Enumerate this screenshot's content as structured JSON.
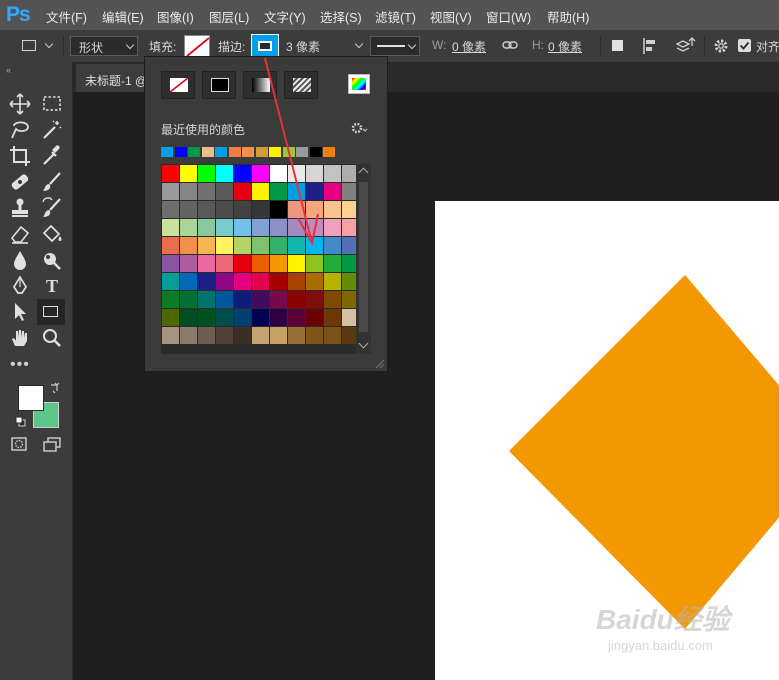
{
  "app": {
    "logo": "Ps"
  },
  "menu": [
    "文件(F)",
    "编辑(E)",
    "图像(I)",
    "图层(L)",
    "文字(Y)",
    "选择(S)",
    "滤镜(T)",
    "视图(V)",
    "窗口(W)",
    "帮助(H)"
  ],
  "options": {
    "mode": "形状",
    "fill_label": "填充:",
    "stroke_label": "描边:",
    "stroke_width": "3 像素",
    "w_label": "W:",
    "w_value": "0 像素",
    "h_label": "H:",
    "h_value": "0 像素",
    "align_label": "对齐"
  },
  "document": {
    "tab_title": "未标题-1 @"
  },
  "popup": {
    "recent_label": "最近使用的颜色",
    "recent_colors": [
      "#00a0e9",
      "#0000ff",
      "#009944",
      "#e6c08c",
      "#00a0e9",
      "#ef7e45",
      "#f19149",
      "#d69c3c",
      "#fff000",
      "#9aca3c",
      "#999999",
      "#000000",
      "#ea8010"
    ],
    "swatch_rows": [
      [
        "#ff0000",
        "#ffff00",
        "#00ff00",
        "#00ffff",
        "#0000ff",
        "#ff00ff",
        "#ffffff",
        "#ebebeb",
        "#d6d6d6",
        "#c2c2c2",
        "#adadad"
      ],
      [
        "#999999",
        "#858585",
        "#707070",
        "#5c5c5c",
        "#e60012",
        "#fff100",
        "#009944",
        "#00a0e9",
        "#1d2088",
        "#e4007f",
        "#808080"
      ],
      [
        "#6e6e6e",
        "#636363",
        "#595959",
        "#4d4d4d",
        "#424242",
        "#363636",
        "#000000",
        "#f09580",
        "#f5a87c",
        "#fac28f",
        "#fcd28e"
      ],
      [
        "#c9e19c",
        "#a9d59b",
        "#88c99d",
        "#7bcaca",
        "#72c0e8",
        "#82a0d5",
        "#8c8fc8",
        "#a489c0",
        "#c18bbe",
        "#f09fbf",
        "#f6a1a3"
      ],
      [
        "#eb6d4a",
        "#f19149",
        "#f8b551",
        "#fff45c",
        "#b3d465",
        "#80c269",
        "#31b16c",
        "#13b5b1",
        "#00b7ee",
        "#448aca",
        "#556fb5"
      ],
      [
        "#8957a1",
        "#ae5da1",
        "#ea68a2",
        "#eb6877",
        "#e60012",
        "#eb6100",
        "#f39800",
        "#fff100",
        "#8fc31f",
        "#22ac38",
        "#009944"
      ],
      [
        "#009e96",
        "#0068b7",
        "#1d2088",
        "#920783",
        "#e4007f",
        "#e5004f",
        "#a40000",
        "#a84200",
        "#aa6c00",
        "#b5b200",
        "#638c0b"
      ],
      [
        "#097c25",
        "#007130",
        "#00736d",
        "#00579e",
        "#0f1d7a",
        "#440b5d",
        "#750b4d",
        "#8c0000",
        "#7e0e0e",
        "#7d4a00",
        "#7f6800"
      ],
      [
        "#4e6800",
        "#004d1f",
        "#00511f",
        "#004f4d",
        "#003f72",
        "#000055",
        "#2f0045",
        "#5d0039",
        "#6b0000",
        "#6a3906",
        "#d6c0a3"
      ],
      [
        "#a69482",
        "#8a7b6b",
        "#6c5f51",
        "#4f4239",
        "#3b3028",
        "#c4a26e",
        "#c7a064",
        "#996c33",
        "#80561b",
        "#7a5118",
        "#5c3a10"
      ]
    ]
  },
  "watermark": {
    "brand": "Baidu经验",
    "url": "jingyan.baidu.com"
  }
}
